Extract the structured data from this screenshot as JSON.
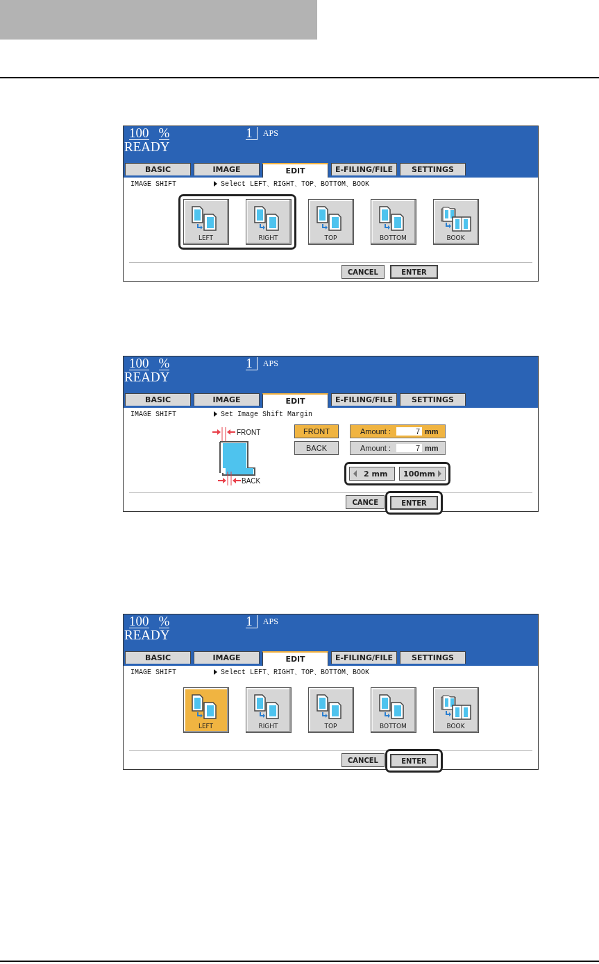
{
  "panels": [
    {
      "kind": "mode_select",
      "status": {
        "zoom": "100",
        "percent": "%",
        "copies": "1",
        "paper": "APS",
        "message": "READY"
      },
      "tabs": [
        {
          "label": "BASIC",
          "selected": false
        },
        {
          "label": "IMAGE",
          "selected": false
        },
        {
          "label": "EDIT",
          "selected": true
        },
        {
          "label": "E-FILING/FILE",
          "selected": false
        },
        {
          "label": "SETTINGS",
          "selected": false
        }
      ],
      "function_label": "IMAGE SHIFT",
      "prompt": "Select LEFT、RIGHT、TOP、BOTTOM、BOOK",
      "modes": [
        {
          "label": "LEFT",
          "kind": "pages",
          "selected": false,
          "callout": true
        },
        {
          "label": "RIGHT",
          "kind": "pages",
          "selected": false,
          "callout": true
        },
        {
          "label": "TOP",
          "kind": "pages",
          "selected": false,
          "callout": false
        },
        {
          "label": "BOTTOM",
          "kind": "pages",
          "selected": false,
          "callout": false
        },
        {
          "label": "BOOK",
          "kind": "book",
          "selected": false,
          "callout": false
        }
      ],
      "cancel": {
        "label": "CANCEL"
      },
      "enter": {
        "label": "ENTER",
        "callout": false
      }
    },
    {
      "kind": "margin",
      "status": {
        "zoom": "100",
        "percent": "%",
        "copies": "1",
        "paper": "APS",
        "message": "READY"
      },
      "tabs": [
        {
          "label": "BASIC",
          "selected": false
        },
        {
          "label": "IMAGE",
          "selected": false
        },
        {
          "label": "EDIT",
          "selected": true
        },
        {
          "label": "E-FILING/FILE",
          "selected": false
        },
        {
          "label": "SETTINGS",
          "selected": false
        }
      ],
      "function_label": "IMAGE SHIFT",
      "prompt": "Set Image Shift Margin",
      "diagram": {
        "front": "FRONT",
        "back": "BACK"
      },
      "sides": [
        {
          "label": "FRONT",
          "selected": true,
          "amount_label": "Amount :",
          "value": "7",
          "unit": "mm"
        },
        {
          "label": "BACK",
          "selected": false,
          "amount_label": "Amount :",
          "value": "7",
          "unit": "mm"
        }
      ],
      "steps": [
        {
          "label": "2 mm",
          "kind": "down"
        },
        {
          "label": "100mm",
          "kind": "up"
        }
      ],
      "steps_callout": true,
      "cancel": {
        "label": "CANCE"
      },
      "enter": {
        "label": "ENTER",
        "callout": true
      }
    },
    {
      "kind": "mode_select",
      "status": {
        "zoom": "100",
        "percent": "%",
        "copies": "1",
        "paper": "APS",
        "message": "READY"
      },
      "tabs": [
        {
          "label": "BASIC",
          "selected": false
        },
        {
          "label": "IMAGE",
          "selected": false
        },
        {
          "label": "EDIT",
          "selected": true
        },
        {
          "label": "E-FILING/FILE",
          "selected": false
        },
        {
          "label": "SETTINGS",
          "selected": false
        }
      ],
      "function_label": "IMAGE SHIFT",
      "prompt": "Select LEFT、RIGHT、TOP、BOTTOM、BOOK",
      "modes": [
        {
          "label": "LEFT",
          "kind": "pages",
          "selected": true,
          "callout": false
        },
        {
          "label": "RIGHT",
          "kind": "pages",
          "selected": false,
          "callout": false
        },
        {
          "label": "TOP",
          "kind": "pages",
          "selected": false,
          "callout": false
        },
        {
          "label": "BOTTOM",
          "kind": "pages",
          "selected": false,
          "callout": false
        },
        {
          "label": "BOOK",
          "kind": "book",
          "selected": false,
          "callout": false
        }
      ],
      "cancel": {
        "label": "CANCEL"
      },
      "enter": {
        "label": "ENTER",
        "callout": true
      }
    }
  ]
}
